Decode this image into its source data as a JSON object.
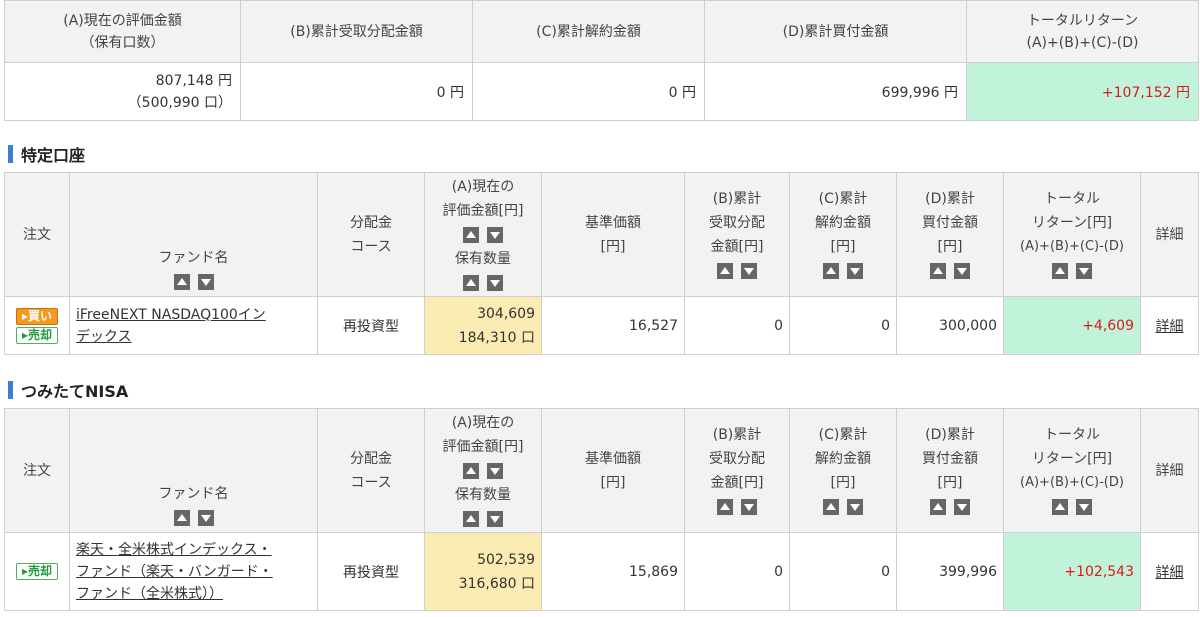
{
  "summary": {
    "headers": {
      "a_line1": "(A)現在の評価金額",
      "a_line2": "（保有口数）",
      "b": "(B)累計受取分配金額",
      "c": "(C)累計解約金額",
      "d": "(D)累計買付金額",
      "tr_line1": "トータルリターン",
      "tr_line2": "(A)+(B)+(C)-(D)"
    },
    "values": {
      "a_amount": "807,148 円",
      "a_units": "（500,990 口）",
      "b": "0 円",
      "c": "0 円",
      "d": "699,996 円",
      "total_return": "+107,152 円"
    }
  },
  "tokutei": {
    "section_title": "特定口座",
    "headers": {
      "order": "注文",
      "fund_name": "ファンド名",
      "course_1": "分配金",
      "course_2": "コース",
      "a_1": "(A)現在の",
      "a_2": "評価金額[円]",
      "a_3": "保有数量",
      "nav_1": "基準価額",
      "nav_2": "[円]",
      "b_1": "(B)累計",
      "b_2": "受取分配",
      "b_3": "金額[円]",
      "c_1": "(C)累計",
      "c_2": "解約金額",
      "c_3": "[円]",
      "d_1": "(D)累計",
      "d_2": "買付金額",
      "d_3": "[円]",
      "tr_1": "トータル",
      "tr_2": "リターン[円]",
      "tr_3": "(A)+(B)+(C)-(D)",
      "detail": "詳細"
    },
    "row": {
      "buy_label": "▸買い",
      "sell_label": "▸売却",
      "fund_line1": "iFreeNEXT NASDAQ100イン",
      "fund_line2": "デックス",
      "course": "再投資型",
      "a_amount": "304,609",
      "a_units": "184,310 口",
      "nav": "16,527",
      "b": "0",
      "c": "0",
      "d": "300,000",
      "total_return": "+4,609",
      "detail": "詳細"
    }
  },
  "nisa": {
    "section_title": "つみたてNISA",
    "headers": {
      "order": "注文",
      "fund_name": "ファンド名",
      "course_1": "分配金",
      "course_2": "コース",
      "a_1": "(A)現在の",
      "a_2": "評価金額[円]",
      "a_3": "保有数量",
      "nav_1": "基準価額",
      "nav_2": "[円]",
      "b_1": "(B)累計",
      "b_2": "受取分配",
      "b_3": "金額[円]",
      "c_1": "(C)累計",
      "c_2": "解約金額",
      "c_3": "[円]",
      "d_1": "(D)累計",
      "d_2": "買付金額",
      "d_3": "[円]",
      "tr_1": "トータル",
      "tr_2": "リターン[円]",
      "tr_3": "(A)+(B)+(C)-(D)",
      "detail": "詳細"
    },
    "row": {
      "sell_label": "▸売却",
      "fund_line1": "楽天・全米株式インデックス・",
      "fund_line2": "ファンド（楽天・バンガード・",
      "fund_line3": "ファンド（全米株式））",
      "course": "再投資型",
      "a_amount": "502,539",
      "a_units": "316,680 口",
      "nav": "15,869",
      "b": "0",
      "c": "0",
      "d": "399,996",
      "total_return": "+102,543",
      "detail": "詳細"
    }
  },
  "colors": {
    "green_cell": "#c1f2da",
    "yellow_cell": "#fbecb3",
    "return_red": "#e01818",
    "section_bar": "#3a7ed6"
  }
}
